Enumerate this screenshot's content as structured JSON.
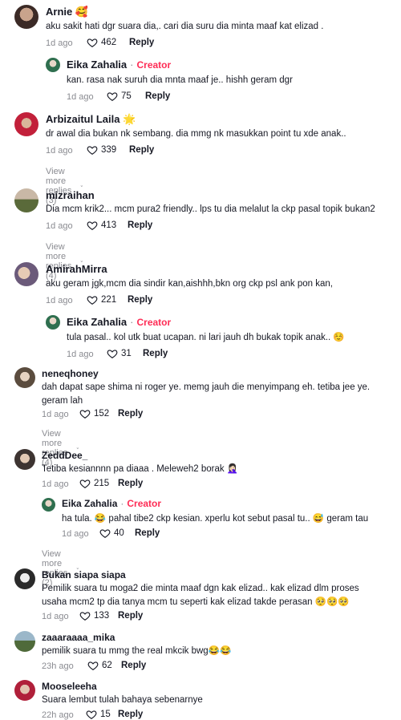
{
  "comments": [
    {
      "user": "Arnie",
      "emoji": "🥰",
      "text": "aku sakit hati dgr suara dia,. cari dia suru dia minta maaf kat elizad .",
      "time": "1d ago",
      "likes": "462"
    },
    {
      "user": "Eika Zahalia",
      "creator": "Creator",
      "text": "kan. rasa nak suruh dia mnta maaf je.. hishh geram dgr",
      "time": "1d ago",
      "likes": "75"
    },
    {
      "user": "Arbizaitul Laila",
      "emoji": "🌟",
      "text": "dr awal dia bukan nk sembang. dia mmg nk masukkan point tu xde anak..",
      "time": "1d ago",
      "likes": "339",
      "more": "View more replies (3)"
    },
    {
      "user": "mizraihan",
      "text": "Dia mcm krik2... mcm pura2 friendly.. lps tu dia melalut la ckp pasal topik bukan2",
      "time": "1d ago",
      "likes": "413",
      "more": "View more replies (4)"
    },
    {
      "user": "AmirahMirra",
      "text": "aku geram jgk,mcm dia sindir kan,aishhh,bkn org ckp psl ank pon kan,",
      "time": "1d ago",
      "likes": "221"
    },
    {
      "user": "Eika Zahalia",
      "creator": "Creator",
      "text": "tula pasal.. kol utk buat ucapan. ni lari jauh dh bukak topik anak.. ☺️",
      "time": "1d ago",
      "likes": "31"
    },
    {
      "user": "neneqhoney",
      "text": "dah dapat sape shima ni roger ye. memg jauh die menyimpang eh. tetiba jee ye. geram lah",
      "time": "1d ago",
      "likes": "152",
      "more": "View more replies (4)"
    },
    {
      "user": "ZeddDee_",
      "text": "Tetiba kesiannnn pa diaaa . Meleweh2 borak 🤦🏻‍♀️",
      "time": "1d ago",
      "likes": "215"
    },
    {
      "user": "Eika Zahalia",
      "creator": "Creator",
      "text": "ha tula. 😂 pahal tibe2 ckp kesian. xperlu kot sebut pasal tu.. 😅 geram tau",
      "time": "1d ago",
      "likes": "40",
      "more": "View more replies (2)"
    },
    {
      "user": "Bukan siapa siapa",
      "text": "Pemilik suara tu moga2 die minta maaf dgn kak elizad.. kak elizad dlm proses usaha mcm2 tp dia tanya mcm tu seperti kak elizad takde perasan 🥺🥺🥺",
      "time": "1d ago",
      "likes": "133"
    },
    {
      "user": "zaaaraaaa_mika",
      "text": "pemilik suara tu mmg the real mkcik bwg😂😂",
      "time": "23h ago",
      "likes": "62"
    },
    {
      "user": "Mooseleeha",
      "text": "Suara lembut tulah bahaya sebenarnye",
      "time": "22h ago",
      "likes": "15"
    }
  ],
  "reply_label": "Reply",
  "colors": {
    "creator": "#fe2c55",
    "muted": "#8a8b91",
    "text": "#161823"
  }
}
